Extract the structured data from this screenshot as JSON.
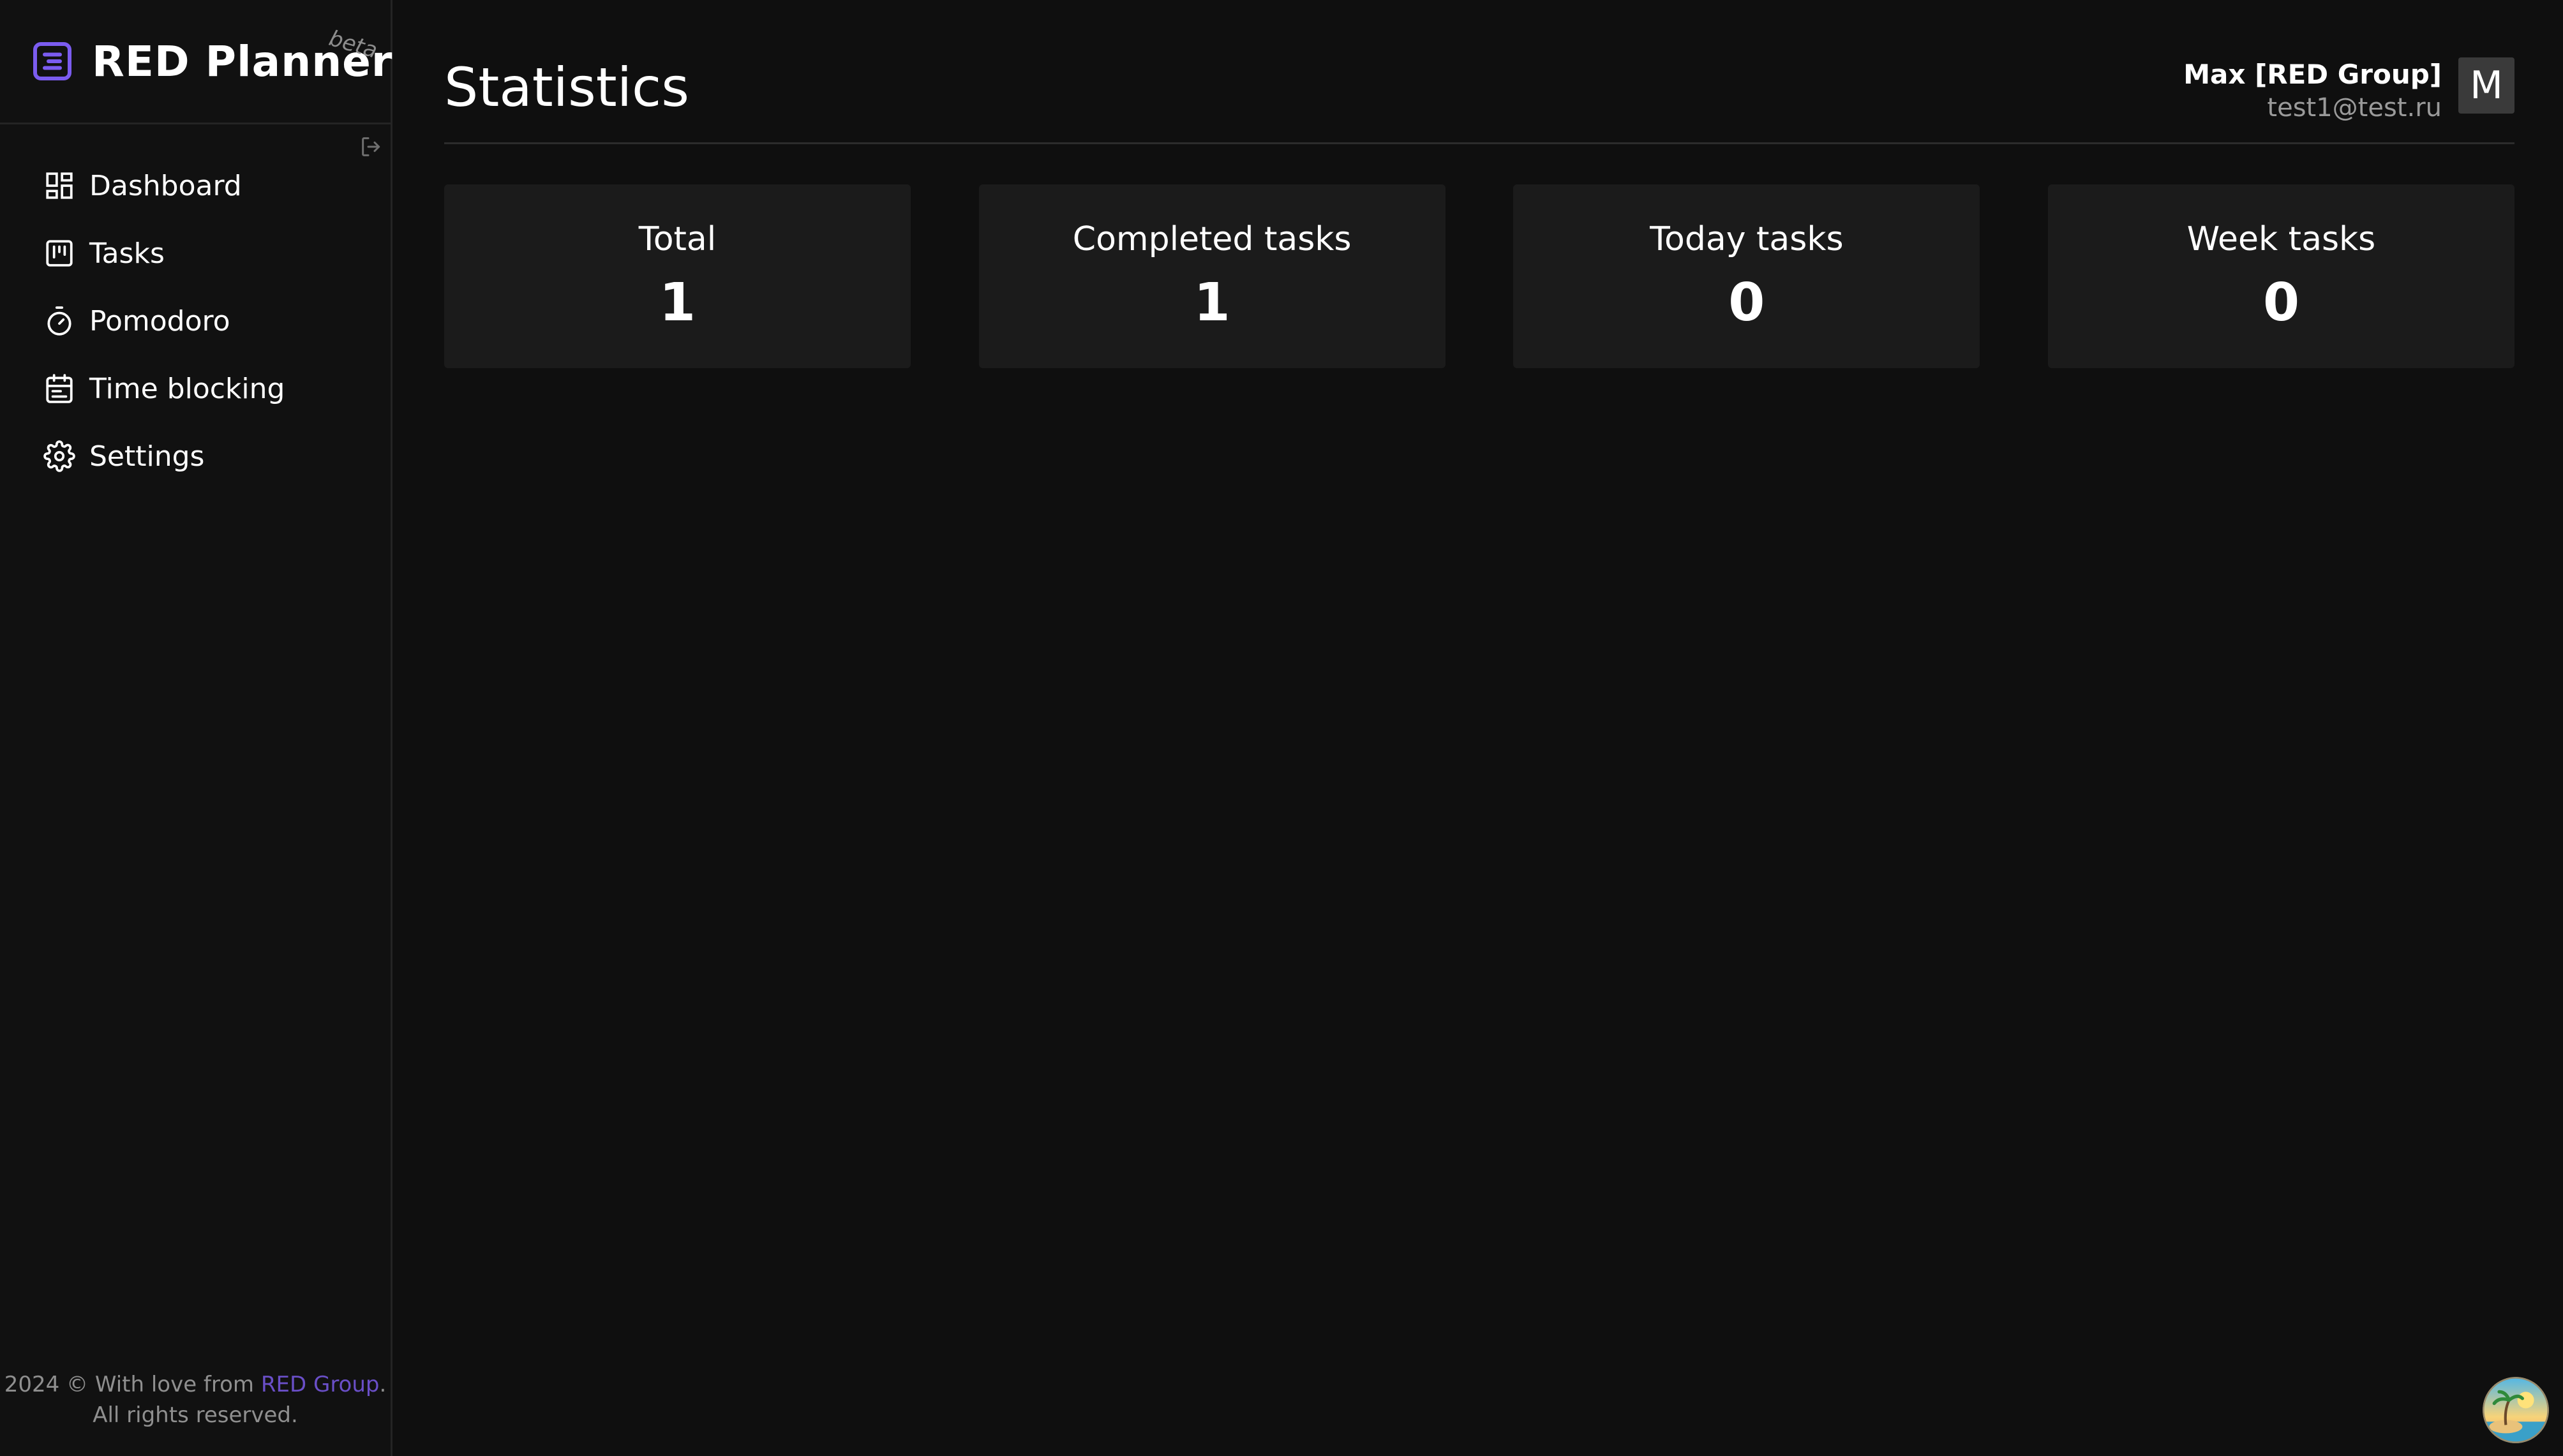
{
  "brand": {
    "name": "RED Planner",
    "tag": "beta",
    "logo_icon": "list-icon",
    "accent": "#7b5cf0"
  },
  "sidebar": {
    "collapse_icon": "logout-icon",
    "items": [
      {
        "label": "Dashboard",
        "icon": "dashboard-icon"
      },
      {
        "label": "Tasks",
        "icon": "kanban-icon"
      },
      {
        "label": "Pomodoro",
        "icon": "timer-icon"
      },
      {
        "label": "Time blocking",
        "icon": "calendar-icon"
      },
      {
        "label": "Settings",
        "icon": "gear-icon"
      }
    ]
  },
  "footer": {
    "prefix": "2024 © With love from ",
    "link": "RED Group",
    "suffix": ".",
    "line2": "All rights reserved."
  },
  "header": {
    "title": "Statistics"
  },
  "user": {
    "name": "Max [RED Group]",
    "email": "test1@test.ru",
    "initial": "M"
  },
  "stats": [
    {
      "label": "Total",
      "value": "1"
    },
    {
      "label": "Completed tasks",
      "value": "1"
    },
    {
      "label": "Today tasks",
      "value": "0"
    },
    {
      "label": "Week tasks",
      "value": "0"
    }
  ],
  "colors": {
    "background": "#0f0f0f",
    "sidebar": "#111111",
    "card": "#1b1b1b",
    "link": "#6a4fc8"
  }
}
